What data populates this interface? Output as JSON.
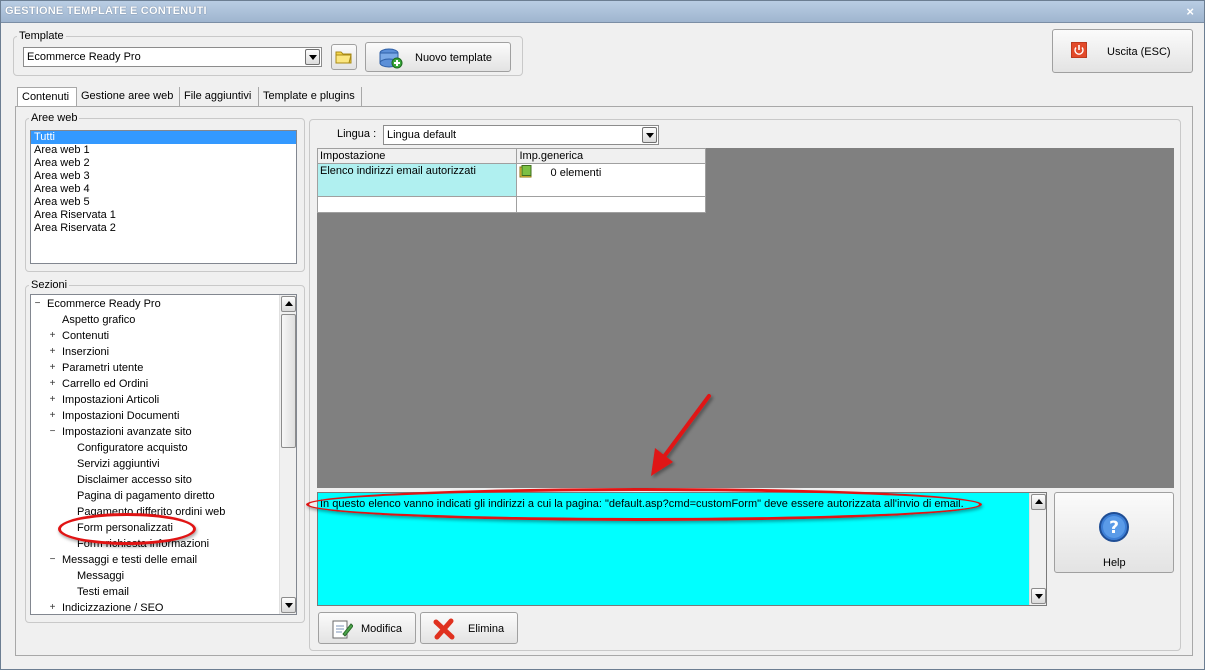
{
  "window": {
    "title": "GESTIONE TEMPLATE E CONTENUTI",
    "close_glyph": "×"
  },
  "template_group": {
    "legend": "Template",
    "selected": "Ecommerce Ready Pro",
    "new_template_label": "Nuovo template"
  },
  "exit_button": {
    "label": "Uscita (ESC)"
  },
  "tabs": [
    {
      "label": "Contenuti",
      "active": true
    },
    {
      "label": "Gestione aree web",
      "active": false
    },
    {
      "label": "File aggiuntivi",
      "active": false
    },
    {
      "label": "Template e plugins",
      "active": false
    }
  ],
  "aree_web": {
    "legend": "Aree web",
    "items": [
      "Tutti",
      "Area web 1",
      "Area web 2",
      "Area web 3",
      "Area web 4",
      "Area web 5",
      "Area Riservata 1",
      "Area Riservata 2"
    ],
    "selected_index": 0
  },
  "sezioni": {
    "legend": "Sezioni",
    "tree": [
      {
        "label": "Ecommerce Ready Pro",
        "level": 0,
        "expander": "−"
      },
      {
        "label": "Aspetto grafico",
        "level": 1,
        "expander": ""
      },
      {
        "label": "Contenuti",
        "level": 1,
        "expander": "+"
      },
      {
        "label": "Inserzioni",
        "level": 1,
        "expander": "+"
      },
      {
        "label": "Parametri utente",
        "level": 1,
        "expander": "+"
      },
      {
        "label": "Carrello ed Ordini",
        "level": 1,
        "expander": "+"
      },
      {
        "label": "Impostazioni Articoli",
        "level": 1,
        "expander": "+"
      },
      {
        "label": "Impostazioni Documenti",
        "level": 1,
        "expander": "+"
      },
      {
        "label": "Impostazioni avanzate sito",
        "level": 1,
        "expander": "−"
      },
      {
        "label": "Configuratore acquisto",
        "level": 2,
        "expander": ""
      },
      {
        "label": "Servizi aggiuntivi",
        "level": 2,
        "expander": ""
      },
      {
        "label": "Disclaimer accesso sito",
        "level": 2,
        "expander": ""
      },
      {
        "label": "Pagina di pagamento diretto",
        "level": 2,
        "expander": ""
      },
      {
        "label": "Pagamento differito ordini web",
        "level": 2,
        "expander": ""
      },
      {
        "label": "Form personalizzati",
        "level": 2,
        "expander": ""
      },
      {
        "label": "Form richiesta informazioni",
        "level": 2,
        "expander": ""
      },
      {
        "label": "Messaggi e testi delle email",
        "level": 1,
        "expander": "−"
      },
      {
        "label": "Messaggi",
        "level": 2,
        "expander": ""
      },
      {
        "label": "Testi email",
        "level": 2,
        "expander": ""
      },
      {
        "label": "Indicizzazione / SEO",
        "level": 1,
        "expander": "+"
      }
    ]
  },
  "lingua": {
    "label": "Lingua :",
    "selected": "Lingua default"
  },
  "settings_grid": {
    "columns": [
      "Impostazione",
      "Imp.generica"
    ],
    "rows": [
      {
        "impostazione": "Elenco indirizzi email autorizzati",
        "value": "0 elementi"
      }
    ]
  },
  "description": "In questo elenco vanno indicati gli indirizzi a cui la pagina: \"default.asp?cmd=customForm\" deve essere autorizzata all'invio di email.",
  "help_button": {
    "label": "Help"
  },
  "actions": {
    "modify_label": "Modifica",
    "delete_label": "Elimina"
  },
  "colors": {
    "titlebar": "#a9bfda",
    "selection": "#3399ff",
    "description_bg": "#00ffff",
    "grid_highlight": "#b0f0f0",
    "grid_background": "#808080",
    "annotation": "#e01414"
  }
}
